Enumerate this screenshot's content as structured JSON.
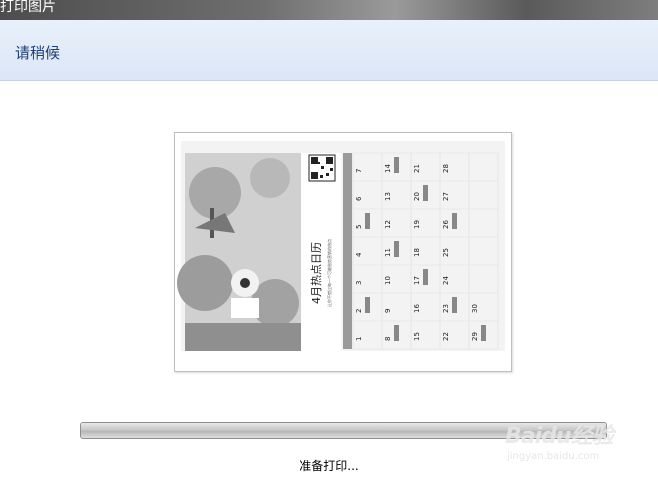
{
  "window": {
    "title": "打印图片"
  },
  "banner": {
    "wait_text": "请稍候"
  },
  "preview": {
    "calendar_title": "4月热点日历",
    "calendar_subtitle": "让你不错过每一个可被借势营销的热点",
    "days": [
      "1",
      "2",
      "3",
      "4",
      "5",
      "6",
      "7",
      "8",
      "9",
      "10",
      "11",
      "12",
      "13",
      "14",
      "15",
      "16",
      "17",
      "18",
      "19",
      "20",
      "21",
      "22",
      "23",
      "24",
      "25",
      "26",
      "27",
      "28",
      "29",
      "30"
    ]
  },
  "progress": {
    "value": 1.0
  },
  "status": {
    "text": "准备打印..."
  },
  "watermark": {
    "logo": "Baidu经验",
    "url": "jingyan.baidu.com"
  }
}
